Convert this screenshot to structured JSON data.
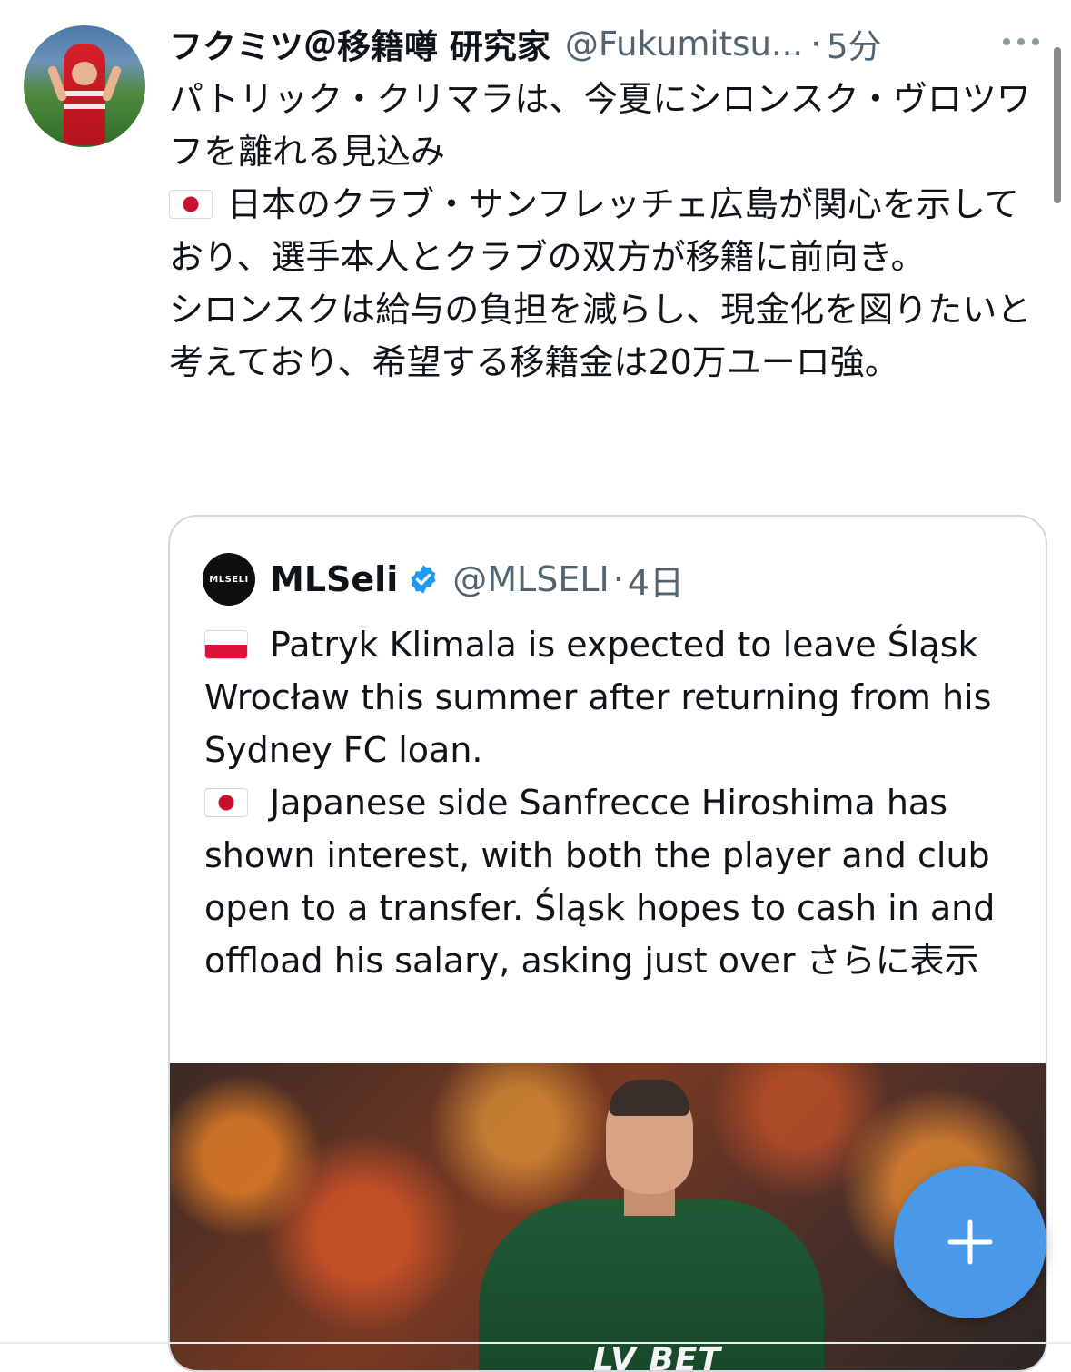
{
  "tweet": {
    "author_name": "フクミツ＠移籍噂 研究家",
    "handle": "@Fukumitsu...",
    "separator": "·",
    "time": "5分",
    "lines": [
      "パトリック・クリマラは、今夏にシロンスク・ヴロツワフを離れる見込み",
      "日本のクラブ・サンフレッチェ広島が関心を示しており、選手本人とクラブの双方が移籍に前向き。",
      "シロンスクは給与の負担を減らし、現金化を図りたいと考えており、希望する移籍金は20万ユーロ強。"
    ],
    "flag_icon": "japan-flag-icon",
    "more_icon": "more-dots-icon"
  },
  "quote": {
    "avatar_text": "MLSELI",
    "author_name": "MLSeli",
    "verified_icon": "verified-badge-icon",
    "handle": "@MLSELI",
    "separator": "·",
    "time": "4日",
    "line1": "Patryk Klimala is expected to leave Śląsk Wrocław this summer after returning from his Sydney FC loan.",
    "line2": "Japanese side Sanfrecce Hiroshima has shown interest, with both the player and club open to a transfer. Śląsk hopes to cash in and offload his salary, asking just over",
    "show_more": "さらに表示",
    "flag1_icon": "poland-flag-icon",
    "flag2_icon": "japan-flag-icon",
    "image": {
      "description_icon": "player-photo",
      "sponsor_text": "LV BET"
    }
  },
  "fab": {
    "icon": "plus-icon"
  },
  "colors": {
    "accent": "#4a99e9",
    "verified": "#1d9bf0",
    "text": "#0f1419",
    "secondary_text": "#536471",
    "border": "#cfd9de"
  }
}
